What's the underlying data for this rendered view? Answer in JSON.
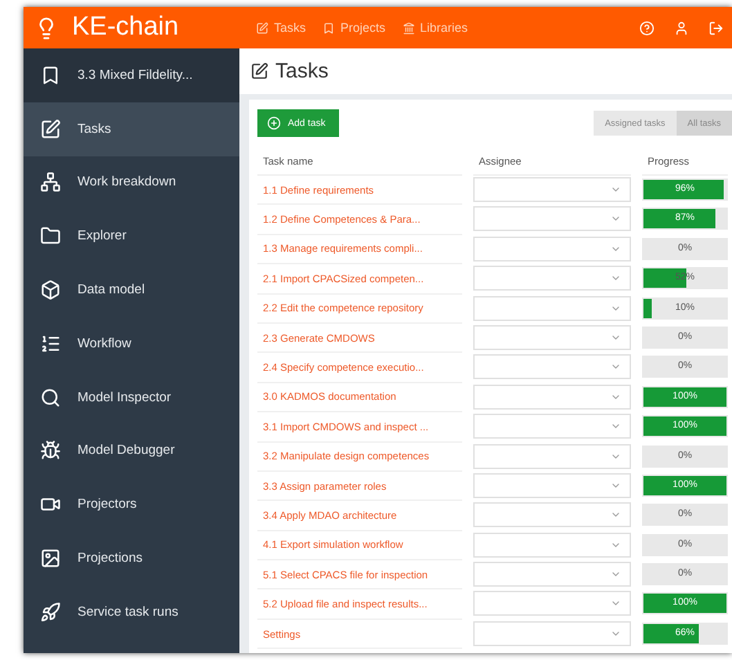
{
  "header": {
    "brand": "KE-chain",
    "nav": [
      "Tasks",
      "Projects",
      "Libraries"
    ]
  },
  "sidebar": {
    "items": [
      {
        "label": "3.3 Mixed Fildelity...",
        "selected": false
      },
      {
        "label": "Tasks",
        "selected": true
      },
      {
        "label": "Work breakdown",
        "selected": false
      },
      {
        "label": "Explorer",
        "selected": false
      },
      {
        "label": "Data model",
        "selected": false
      },
      {
        "label": "Workflow",
        "selected": false
      },
      {
        "label": "Model Inspector",
        "selected": false
      },
      {
        "label": "Model Debugger",
        "selected": false
      },
      {
        "label": "Projectors",
        "selected": false
      },
      {
        "label": "Projections",
        "selected": false
      },
      {
        "label": "Service task runs",
        "selected": false
      }
    ]
  },
  "page": {
    "title": "Tasks",
    "add_button": "Add task",
    "filters": [
      {
        "label": "Assigned tasks",
        "selected": false
      },
      {
        "label": "All tasks",
        "selected": true
      }
    ]
  },
  "table": {
    "columns": [
      "Task name",
      "Assignee",
      "Progress"
    ],
    "rows": [
      {
        "name": "1.1  Define requirements",
        "level": 0.96,
        "reading": "96%"
      },
      {
        "name": "1.2  Define Competences & Para...",
        "level": 0.87,
        "reading": "87%"
      },
      {
        "name": "1.3  Manage requirements compli...",
        "reading": "0%"
      },
      {
        "name": "2.1  Import CPACSized competen...",
        "level": 0.52,
        "reading": "52%"
      },
      {
        "name": "2.2  Edit the competence repository",
        "level": 0.1,
        "reading": "10%"
      },
      {
        "name": "2.3  Generate CMDOWS",
        "reading": "0%"
      },
      {
        "name": "2.4  Specify competence executio...",
        "reading": "0%"
      },
      {
        "name": "3.0 KADMOS documentation",
        "level": 1,
        "reading": "100%"
      },
      {
        "name": "3.1  Import CMDOWS and inspect ...",
        "level": 1,
        "reading": "100%"
      },
      {
        "name": "3.2  Manipulate design competences",
        "reading": "0%"
      },
      {
        "name": "3.3  Assign parameter roles",
        "level": 1,
        "reading": "100%"
      },
      {
        "name": "3.4  Apply MDAO architecture",
        "reading": "0%"
      },
      {
        "name": "4.1  Export simulation workflow",
        "reading": "0%"
      },
      {
        "name": "5.1  Select CPACS file for inspection",
        "reading": "0%"
      },
      {
        "name": "5.2  Upload file and inspect results...",
        "level": 1,
        "reading": "100%"
      },
      {
        "name": "Settings",
        "level": 0.66,
        "reading": "66%"
      }
    ]
  }
}
